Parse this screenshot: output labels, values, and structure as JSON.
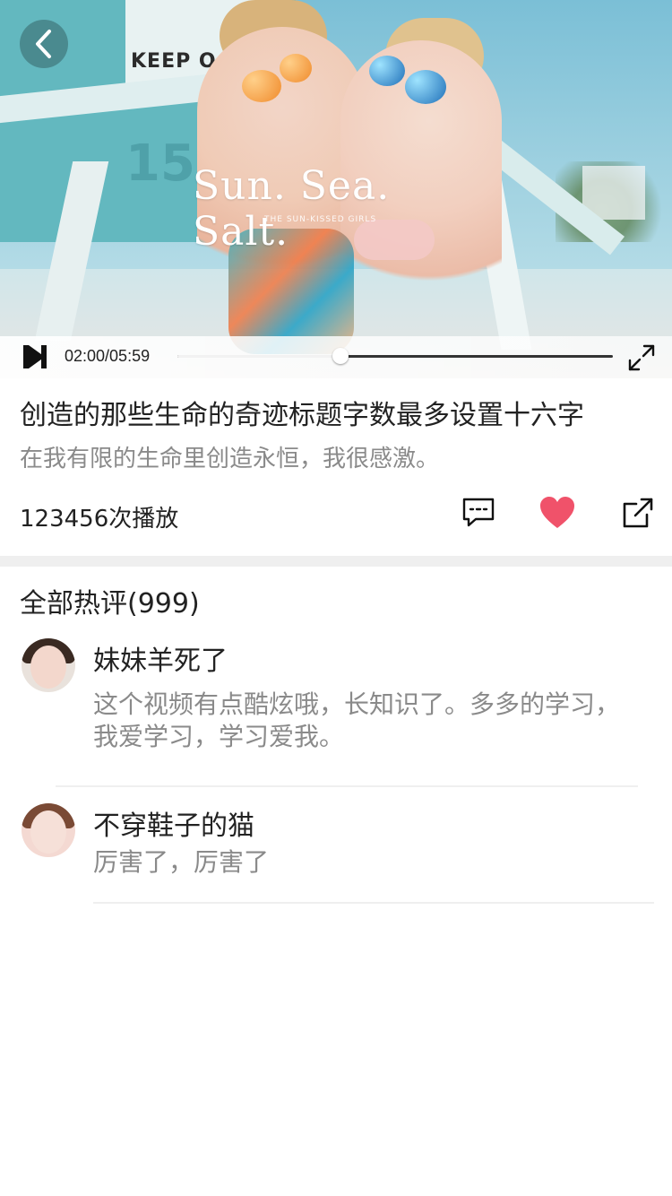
{
  "video": {
    "overlay_title": "Sun. Sea. Salt.",
    "overlay_subtitle": "THE SUN-KISSED GIRLS",
    "sign_text": "KEEP O",
    "tower_number": "150",
    "back_icon": "chevron-left-icon",
    "current_time": "02:00",
    "total_time": "05:59",
    "time_text": "02:00/05:59",
    "progress": 0.375,
    "fullscreen_icon": "expand-icon"
  },
  "info": {
    "title": "创造的那些生命的奇迹标题字数最多设置十六字",
    "subtitle": "在我有限的生命里创造永恒，我很感激。",
    "plays": "123456次播放",
    "comment_icon": "comment-icon",
    "like_icon": "heart-icon",
    "share_icon": "share-icon",
    "like_color": "#f0526a"
  },
  "comments": {
    "header": "全部热评(999)",
    "items": [
      {
        "name": "妹妹羊死了",
        "text": "这个视频有点酷炫哦，长知识了。多多的学习，我爱学习，学习爱我。"
      },
      {
        "name": "不穿鞋子的猫",
        "text": "厉害了，厉害了"
      }
    ]
  }
}
